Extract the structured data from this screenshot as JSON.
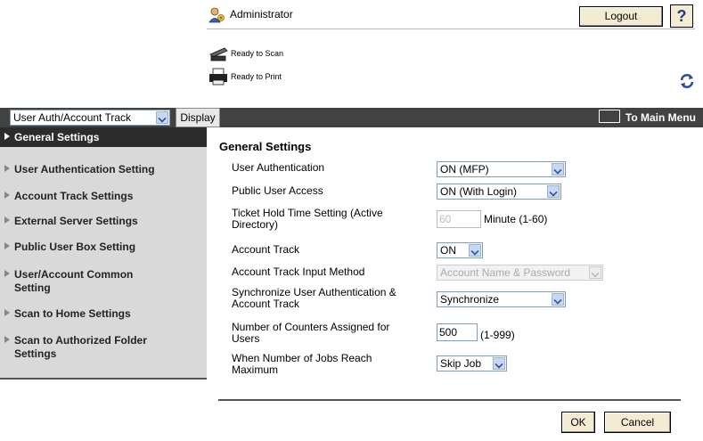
{
  "header": {
    "user_label": "Administrator",
    "logout_label": "Logout",
    "help_label": "?",
    "scan_status": "Ready to Scan",
    "print_status": "Ready to Print"
  },
  "toolbar": {
    "mode_select_value": "User Auth/Account Track",
    "display_label": "Display",
    "main_menu_label": "To Main Menu"
  },
  "sidebar": {
    "items": [
      {
        "label": "General Settings",
        "active": true
      },
      {
        "label": "User Authentication Setting"
      },
      {
        "label": "Account Track Settings"
      },
      {
        "label": "External Server Settings"
      },
      {
        "label": "Public User Box Setting"
      },
      {
        "label": "User/Account Common Setting"
      },
      {
        "label": "Scan to Home Settings"
      },
      {
        "label": "Scan to Authorized Folder Settings"
      }
    ]
  },
  "main": {
    "title": "General Settings",
    "rows": [
      {
        "label": "User Authentication",
        "value": "ON (MFP)"
      },
      {
        "label": "Public User Access",
        "value": "ON (With Login)"
      },
      {
        "label": "Ticket Hold Time Setting (Active Directory)",
        "value": "60",
        "unit": "Minute (1-60)"
      },
      {
        "label": "Account Track",
        "value": "ON"
      },
      {
        "label": "Account Track Input Method",
        "value": "Account Name & Password"
      },
      {
        "label": "Synchronize User Authentication & Account Track",
        "value": "Synchronize"
      },
      {
        "label": "Number of Counters Assigned for Users",
        "value": "500",
        "unit": "(1-999)"
      },
      {
        "label": "When Number of Jobs Reach Maximum",
        "value": "Skip Job"
      }
    ],
    "ok_label": "OK",
    "cancel_label": "Cancel"
  },
  "colors": {
    "bar": "#424242",
    "sidebar": "#d9d9d9",
    "sidebar_active": "#2c2c2c",
    "button": "#f3ecd2"
  }
}
